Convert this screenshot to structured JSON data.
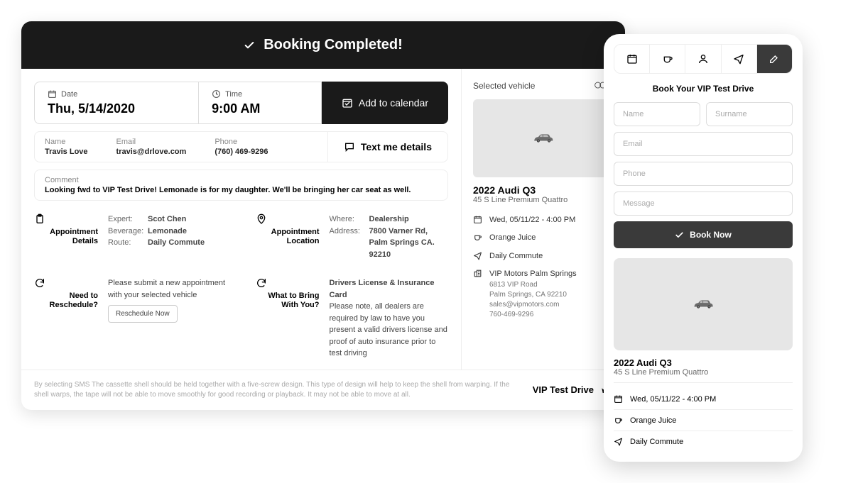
{
  "banner": "Booking Completed!",
  "date": {
    "label": "Date",
    "value": "Thu, 5/14/2020"
  },
  "time": {
    "label": "Time",
    "value": "9:00 AM"
  },
  "actions": {
    "addCalendar": "Add to calendar",
    "textDetails": "Text me details"
  },
  "customer": {
    "name": {
      "k": "Name",
      "v": "Travis Love"
    },
    "email": {
      "k": "Email",
      "v": "travis@drlove.com"
    },
    "phone": {
      "k": "Phone",
      "v": "(760) 469-9296"
    }
  },
  "comment": {
    "k": "Comment",
    "v": "Looking fwd to VIP Test Drive! Lemonade is for my daughter. We'll be bringing her car seat as well."
  },
  "details": {
    "title": "Appointment Details",
    "expert": {
      "k": "Expert",
      "v": "Scot Chen"
    },
    "beverage": {
      "k": "Beverage",
      "v": "Lemonade"
    },
    "route": {
      "k": "Route",
      "v": "Daily Commute"
    }
  },
  "location": {
    "title": "Appointment Location",
    "where": {
      "k": "Where",
      "v": "Dealership"
    },
    "address": {
      "k": "Address",
      "v": "7800 Varner Rd, Palm Springs CA. 92210"
    }
  },
  "reschedule": {
    "title": "Need to Reschedule?",
    "body": "Please submit a new appointment with your selected vehicle",
    "btn": "Reschedule Now"
  },
  "bring": {
    "title": "What to Bring With You?",
    "heading": "Drivers License & Insurance Card",
    "body": "Please note, all dealers are required by law to have you present a valid drivers license and proof of auto insurance prior to test driving"
  },
  "vehicle": {
    "head": "Selected vehicle",
    "name": "2022 Audi Q3",
    "trim": "45 S Line Premium Quattro",
    "datetime": "Wed, 05/11/22 - 4:00 PM",
    "beverage": "Orange Juice",
    "route": "Daily Commute",
    "dealer": "VIP Motors Palm Springs",
    "addr1": "6813 VIP Road",
    "addr2": "Palm Springs, CA 92210",
    "addrEmail": "sales@vipmotors.com",
    "addrPhone": "760-469-9296"
  },
  "footer": {
    "disclaimer": "By selecting SMS The cassette shell should be held together with a five-screw design. This type of design will help to keep the shell from warping. If the shell warps, the tape will not be able to move smoothly for good recording or playback. It may not be able to move at all.",
    "brand": "VIP Test Drive"
  },
  "mobile": {
    "title": "Book Your VIP Test Drive",
    "placeholders": {
      "name": "Name",
      "surname": "Surname",
      "email": "Email",
      "phone": "Phone",
      "message": "Message"
    },
    "btn": "Book Now",
    "carName": "2022 Audi Q3",
    "carTrim": "45 S Line Premium Quattro",
    "datetime": "Wed, 05/11/22 - 4:00 PM",
    "beverage": "Orange Juice",
    "route": "Daily Commute"
  }
}
